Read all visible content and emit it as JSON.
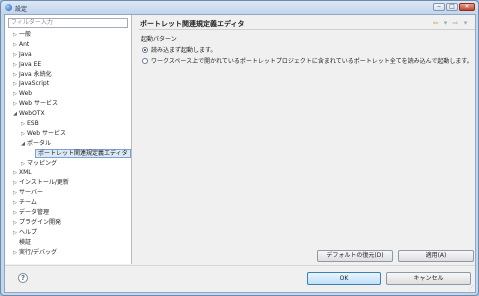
{
  "window": {
    "title": "設定",
    "minimize_glyph": "‒",
    "maximize_glyph": "□",
    "close_glyph": "✕"
  },
  "sidebar": {
    "filter_placeholder": "フィルター入力",
    "items": [
      {
        "label": "一般",
        "twisty": "▷"
      },
      {
        "label": "Ant",
        "twisty": "▷"
      },
      {
        "label": "Java",
        "twisty": "▷"
      },
      {
        "label": "Java EE",
        "twisty": "▷"
      },
      {
        "label": "Java 永続化",
        "twisty": "▷"
      },
      {
        "label": "JavaScript",
        "twisty": "▷"
      },
      {
        "label": "Web",
        "twisty": "▷"
      },
      {
        "label": "Web サービス",
        "twisty": "▷"
      },
      {
        "label": "WebOTX",
        "twisty": "◢"
      },
      {
        "label": "ESB",
        "twisty": "▷"
      },
      {
        "label": "Web サービス",
        "twisty": "▷"
      },
      {
        "label": "ポータル",
        "twisty": "◢"
      },
      {
        "label": "ポートレット関連規定義エディタ",
        "twisty": ""
      },
      {
        "label": "マッピング",
        "twisty": "▷"
      },
      {
        "label": "XML",
        "twisty": "▷"
      },
      {
        "label": "インストール/更新",
        "twisty": "▷"
      },
      {
        "label": "サーバー",
        "twisty": "▷"
      },
      {
        "label": "チーム",
        "twisty": "▷"
      },
      {
        "label": "データ管理",
        "twisty": "▷"
      },
      {
        "label": "プラグイン開発",
        "twisty": "▷"
      },
      {
        "label": "ヘルプ",
        "twisty": "▷"
      },
      {
        "label": "検証",
        "twisty": ""
      },
      {
        "label": "実行/デバッグ",
        "twisty": "▷"
      }
    ]
  },
  "main": {
    "title": "ポートレット関連規定義エディタ",
    "nav": {
      "back": "⇦",
      "back_menu": "▾",
      "forward": "⇨",
      "forward_menu": "▾"
    },
    "group_label": "起動パターン",
    "options": [
      {
        "label": "読み込まず起動します。",
        "selected": true
      },
      {
        "label": "ワークスペース上で開かれているポートレットプロジェクトに含まれているポートレット全てを読み込んで起動します。",
        "selected": false
      }
    ],
    "restore_defaults": "デフォルトの復元(D)",
    "apply": "適用(A)"
  },
  "footer": {
    "help_glyph": "?",
    "ok": "OK",
    "cancel": "キャンセル"
  }
}
